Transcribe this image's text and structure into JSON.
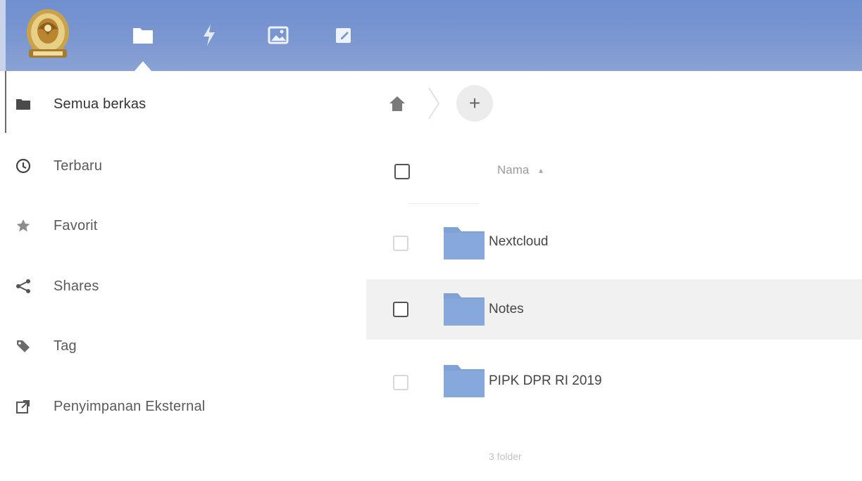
{
  "header": {
    "apps": [
      {
        "name": "files",
        "icon": "folder-icon",
        "active": true
      },
      {
        "name": "activity",
        "icon": "lightning-icon",
        "active": false
      },
      {
        "name": "photos",
        "icon": "image-icon",
        "active": false
      },
      {
        "name": "notes",
        "icon": "pencil-note-icon",
        "active": false
      }
    ],
    "colors": {
      "bar": "#7b97d0",
      "icon": "#ffffff"
    }
  },
  "sidebar": {
    "items": [
      {
        "label": "Semua berkas",
        "icon": "folder-icon",
        "active": true
      },
      {
        "label": "Terbaru",
        "icon": "clock-icon",
        "active": false
      },
      {
        "label": "Favorit",
        "icon": "star-icon",
        "active": false
      },
      {
        "label": "Shares",
        "icon": "share-icon",
        "active": false
      },
      {
        "label": "Tag",
        "icon": "tag-icon",
        "active": false
      },
      {
        "label": "Penyimpanan Eksternal",
        "icon": "external-link-icon",
        "active": false
      }
    ]
  },
  "breadcrumb": {
    "home_icon": "home-icon",
    "add_label": "+"
  },
  "filelist": {
    "column_name": "Nama",
    "sort_indicator": "▴",
    "rows": [
      {
        "name": "Nextcloud"
      },
      {
        "name": "Notes"
      },
      {
        "name": "PIPK DPR RI 2019"
      }
    ],
    "summary": "3 folder",
    "folder_color": "#7fa2d6"
  }
}
